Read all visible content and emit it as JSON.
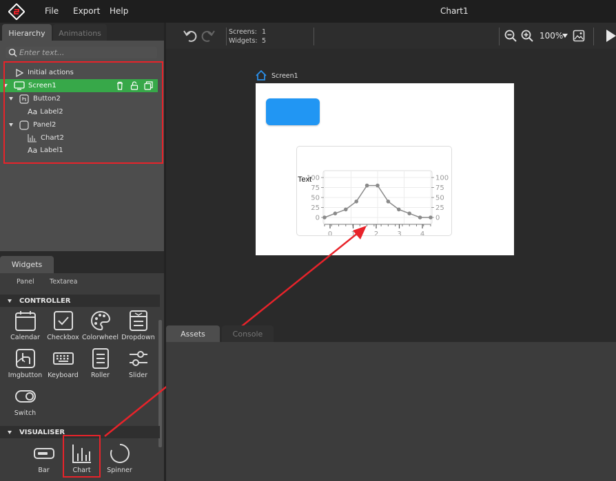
{
  "menu": {
    "file": "File",
    "export": "Export",
    "help": "Help"
  },
  "app_title": "Chart1",
  "left_tabs": {
    "hierarchy": "Hierarchy",
    "animations": "Animations"
  },
  "search": {
    "placeholder": "Enter text..."
  },
  "tree": {
    "initial_actions": "Initial actions",
    "screen1": "Screen1",
    "button2": "Button2",
    "label2": "Label2",
    "panel2": "Panel2",
    "chart2": "Chart2",
    "label1": "Label1",
    "label_icon_text": "Aa"
  },
  "widgets_tab": "Widgets",
  "widgets_partial": {
    "panel": "Panel",
    "textarea": "Textarea"
  },
  "sections": {
    "controller": "CONTROLLER",
    "visualiser": "VISUALISER"
  },
  "controller_widgets": [
    "Calendar",
    "Checkbox",
    "Colorwheel",
    "Dropdown",
    "Imgbutton",
    "Keyboard",
    "Roller",
    "Slider",
    "Switch"
  ],
  "visualiser_widgets": [
    "Bar",
    "Chart",
    "Spinner"
  ],
  "toolbar": {
    "screens_label": "Screens:",
    "screens_value": "1",
    "widgets_label": "Widgets:",
    "widgets_value": "5",
    "zoom": "100%"
  },
  "screen_name": "Screen1",
  "chart_widget_label": "Text",
  "bottom_tabs": {
    "assets": "Assets",
    "console": "Console"
  },
  "colors": {
    "accent_green": "#37a849",
    "annotation_red": "#e8232a",
    "button_blue": "#2196f3",
    "home_blue": "#2a8ee8"
  },
  "chart_data": {
    "type": "line",
    "x": [
      0,
      0.5,
      1,
      1.5,
      2,
      2.5,
      3,
      3.5,
      4,
      4.5,
      5
    ],
    "values": [
      0,
      10,
      20,
      40,
      80,
      80,
      40,
      20,
      10,
      0,
      0
    ],
    "y_ticks": [
      "100",
      "75",
      "50",
      "25",
      "0"
    ],
    "y_ticks_right": [
      "100",
      "75",
      "50",
      "25",
      "0"
    ],
    "x_ticks": [
      "0",
      "1",
      "2",
      "3",
      "4"
    ],
    "ylim": [
      0,
      100
    ],
    "grid": true
  }
}
